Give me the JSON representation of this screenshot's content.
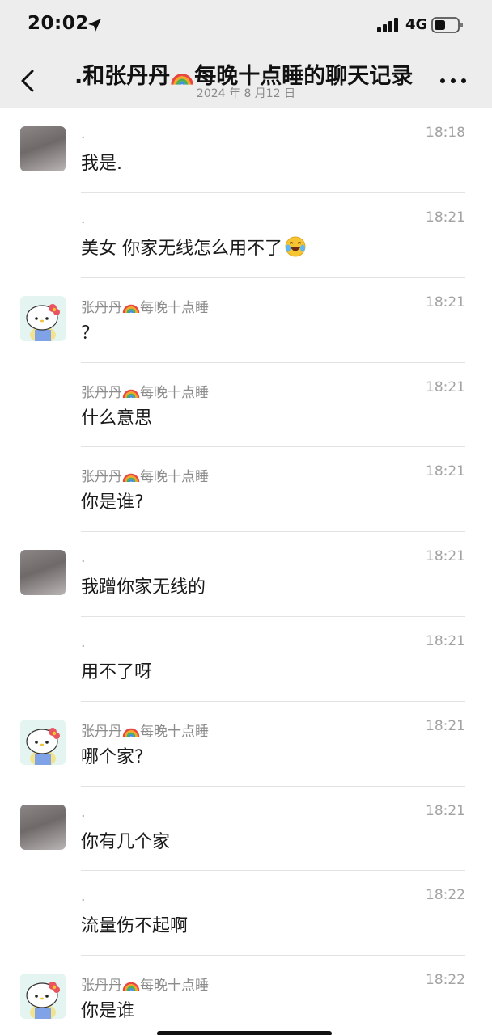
{
  "status_bar": {
    "time": "20:02",
    "network": "4G"
  },
  "nav": {
    "title_prefix": ".和张丹丹",
    "title_suffix": "每晚十点睡的聊天记录",
    "date": "2024 年 8 月12 日"
  },
  "contact": {
    "name_prefix": "张丹丹",
    "name_suffix": "每晚十点睡"
  },
  "messages": [
    {
      "sender": ".",
      "time": "18:18",
      "text": "我是."
    },
    {
      "sender": ".",
      "time": "18:21",
      "text": "美女 你家无线怎么用不了"
    },
    {
      "sender": "张丹丹🌈每晚十点睡",
      "time": "18:21",
      "text": "？"
    },
    {
      "sender": "张丹丹🌈每晚十点睡",
      "time": "18:21",
      "text": "什么意思"
    },
    {
      "sender": "张丹丹🌈每晚十点睡",
      "time": "18:21",
      "text": "你是谁?"
    },
    {
      "sender": ".",
      "time": "18:21",
      "text": "我蹭你家无线的"
    },
    {
      "sender": ".",
      "time": "18:21",
      "text": "用不了呀"
    },
    {
      "sender": "张丹丹🌈每晚十点睡",
      "time": "18:21",
      "text": "哪个家?"
    },
    {
      "sender": ".",
      "time": "18:21",
      "text": "你有几个家"
    },
    {
      "sender": ".",
      "time": "18:22",
      "text": "流量伤不起啊"
    },
    {
      "sender": "张丹丹🌈每晚十点睡",
      "time": "18:22",
      "text": "你是谁"
    }
  ],
  "icons": {
    "location": "location-arrow-icon",
    "signal": "cellular-signal-icon",
    "battery": "battery-icon",
    "back": "chevron-left-icon",
    "more": "more-dots-icon",
    "rainbow": "rainbow-emoji-icon",
    "laugh": "laughing-crying-emoji-icon"
  },
  "colors": {
    "topbar": "#ededed",
    "time_text": "#a3a3a3",
    "sender_text": "#8c8c8c"
  }
}
